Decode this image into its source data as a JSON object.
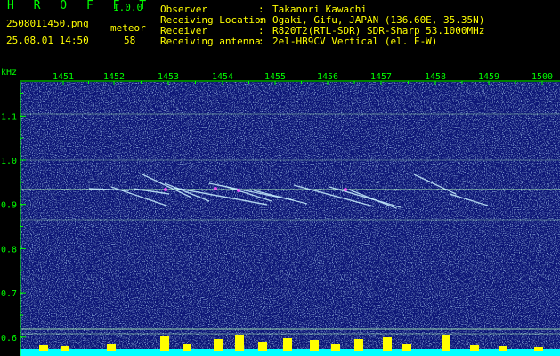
{
  "header": {
    "app_title": "H R O F F T",
    "version": "1.0.0",
    "filename": "2508011450.png",
    "datetime": "25.08.01 14:50",
    "meteor_label": "meteor",
    "meteor_count": "58"
  },
  "info": [
    {
      "label": "Observer",
      "value": "Takanori Kawachi"
    },
    {
      "label": "Receiving Location",
      "value": "Ogaki, Gifu, JAPAN (136.60E, 35.35N)"
    },
    {
      "label": "Receiver",
      "value": "R820T2(RTL-SDR) SDR-Sharp 53.1000MHz"
    },
    {
      "label": "Receiving antenna",
      "value": "2el-HB9CV Vertical (el. E-W)"
    }
  ],
  "plot": {
    "y_unit": "kHz",
    "time_labels": [
      "1451",
      "1452",
      "1453",
      "1454",
      "1455",
      "1456",
      "1457",
      "1458",
      "1459",
      "1500"
    ],
    "freq_labels": [
      "1.1",
      "1.0",
      "0.9",
      "0.8",
      "0.7",
      "0.6"
    ],
    "colors": {
      "background": "#0a1478",
      "axis": "#00ff00",
      "carrier": "#b4ffb4",
      "meteor": "#c8f0ff",
      "meteor_head": "#ff50ff",
      "power_bar": "#ffff00",
      "baseline": "#00ffff"
    }
  }
}
